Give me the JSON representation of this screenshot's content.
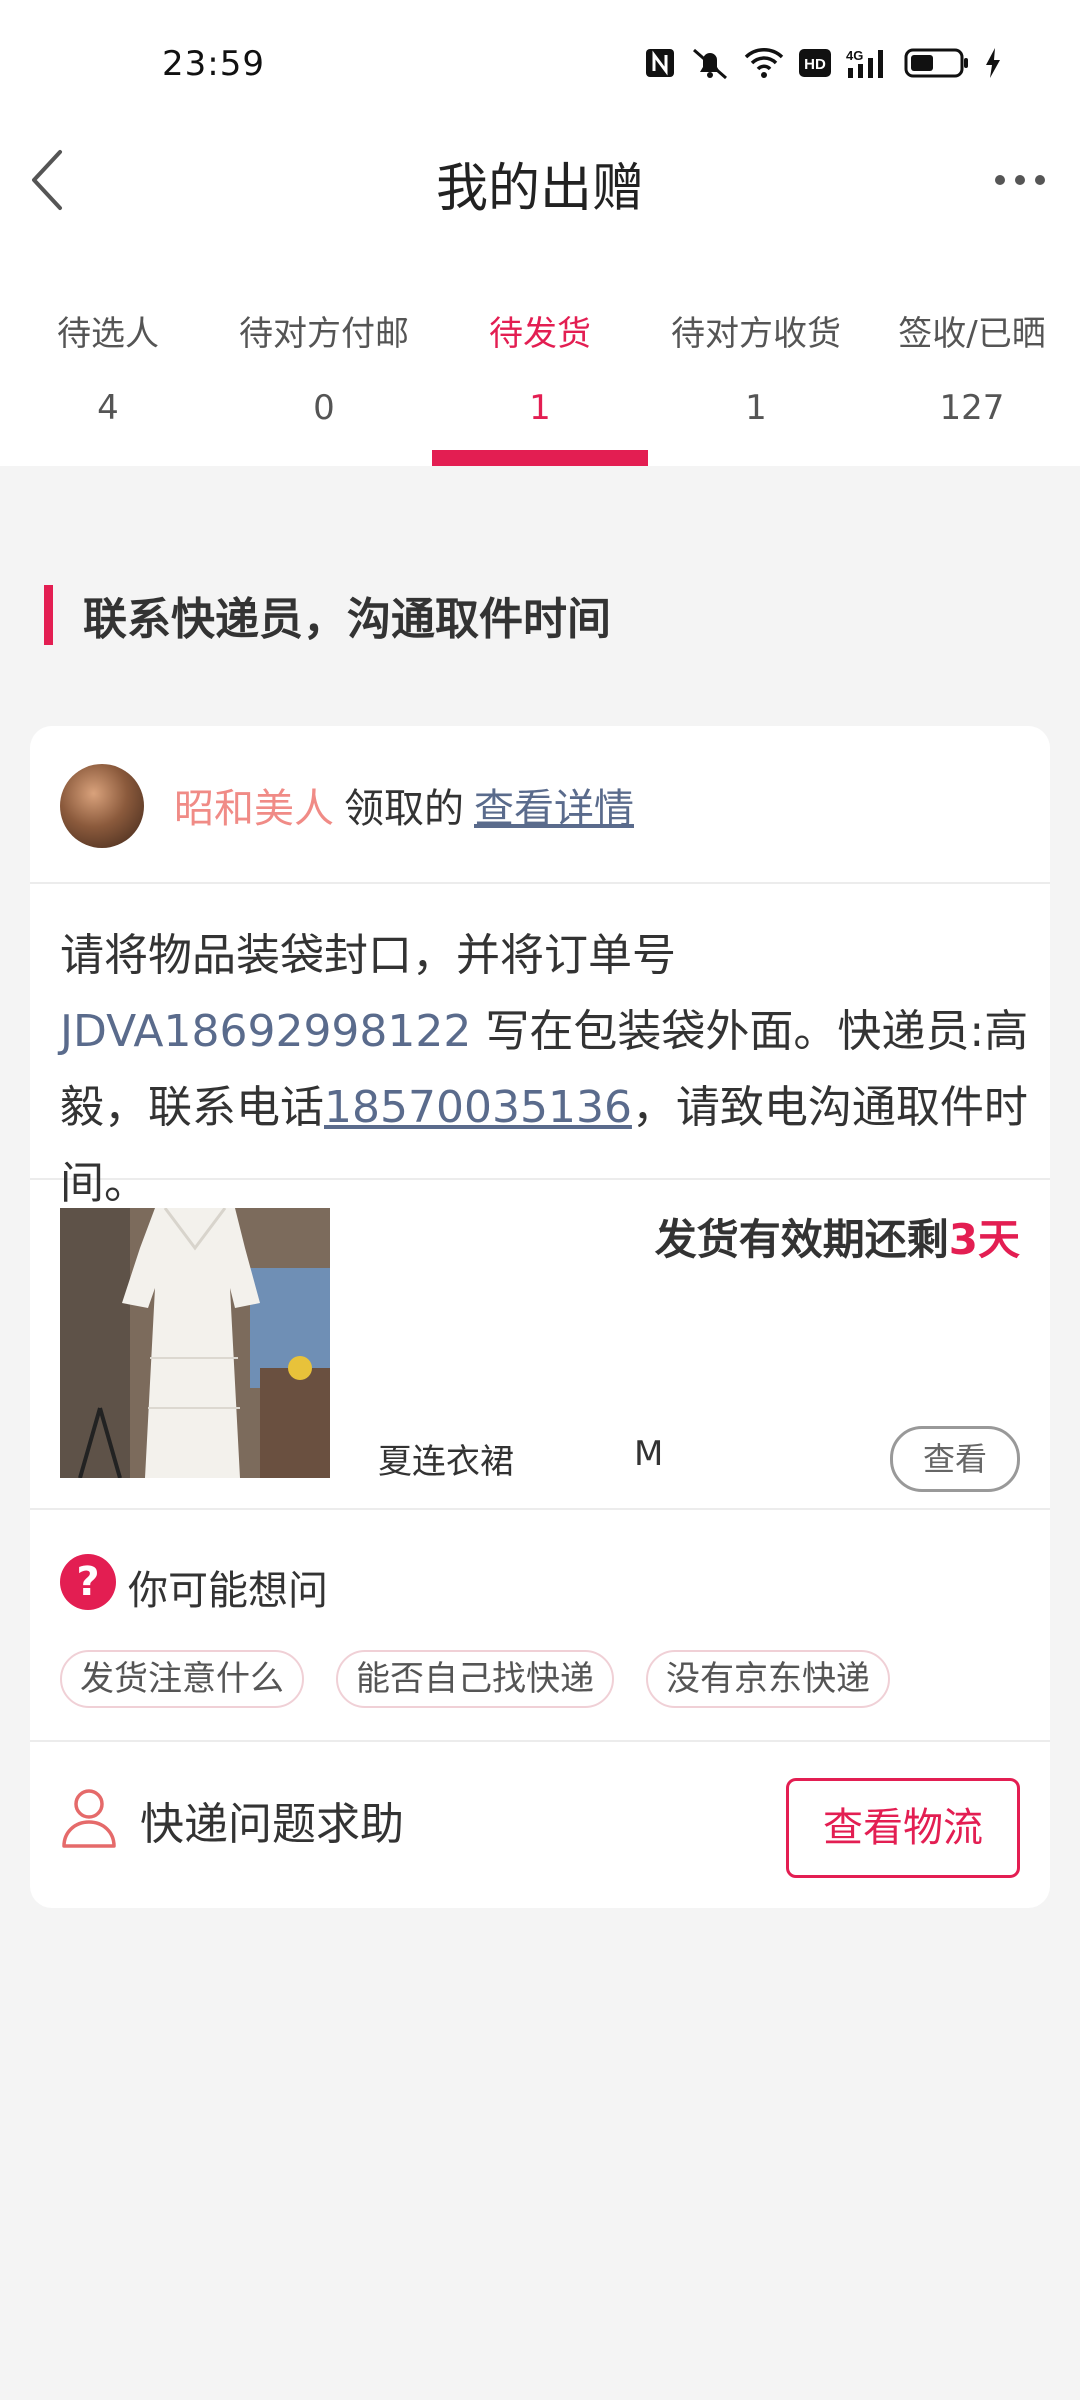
{
  "status_bar": {
    "time": "23:59"
  },
  "header": {
    "title": "我的出赠"
  },
  "tabs": [
    {
      "label": "待选人",
      "count": "4"
    },
    {
      "label": "待对方付邮",
      "count": "0"
    },
    {
      "label": "待发货",
      "count": "1"
    },
    {
      "label": "待对方收货",
      "count": "1"
    },
    {
      "label": "签收/已晒",
      "count": "127"
    }
  ],
  "active_tab_index": 2,
  "section": {
    "heading": "联系快递员，沟通取件时间"
  },
  "card": {
    "user": {
      "name": "昭和美人",
      "claimed_text": "领取的",
      "detail_link": "查看详情"
    },
    "instruction": {
      "part1": "请将物品装袋封口，并将订单号 ",
      "order_no": "JDVA18692998122",
      "part2": " 写在包装袋外面。快递员:高毅，联系电话",
      "phone": "18570035136",
      "part3": "，请致电沟通取件时间。"
    },
    "item": {
      "deadline_prefix": "发货有效期还剩",
      "deadline_days": "3天",
      "name": "夏连衣裙",
      "size": "M",
      "view_button": "查看"
    },
    "faq": {
      "title": "你可能想问",
      "chips": [
        "发货注意什么",
        "能否自己找快递",
        "没有京东快递"
      ]
    },
    "help": {
      "label": "快递问题求助",
      "logistics_button": "查看物流"
    }
  },
  "colors": {
    "accent": "#e31e52",
    "link": "#5a6b8c",
    "username": "#f08b86",
    "background": "#f4f4f4"
  },
  "icons": [
    "nfc-icon",
    "mute-icon",
    "wifi-icon",
    "hd-icon",
    "signal-4g-icon",
    "battery-icon",
    "charging-icon",
    "back-arrow-icon",
    "more-icon",
    "question-icon",
    "person-icon"
  ]
}
